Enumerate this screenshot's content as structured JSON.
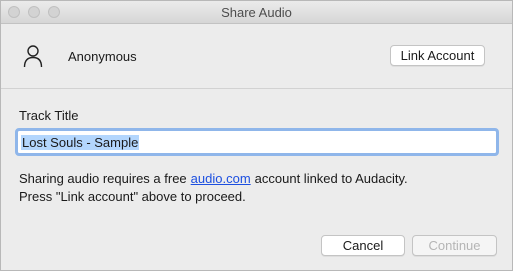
{
  "window": {
    "title": "Share Audio"
  },
  "account": {
    "user_icon": "user-icon",
    "name": "Anonymous",
    "link_button": "Link Account"
  },
  "track": {
    "label": "Track Title",
    "value": "Lost Souls - Sample"
  },
  "info": {
    "line1_before": "Sharing audio requires a free",
    "link_text": "audio.com",
    "line1_after": "account linked to Audacity.",
    "line2": "Press \"Link account\" above to proceed."
  },
  "buttons": {
    "cancel": "Cancel",
    "continue": "Continue"
  },
  "colors": {
    "link": "#1c4fe0",
    "selection": "#b3d6fd",
    "focus_ring": "#8fb6ea"
  }
}
